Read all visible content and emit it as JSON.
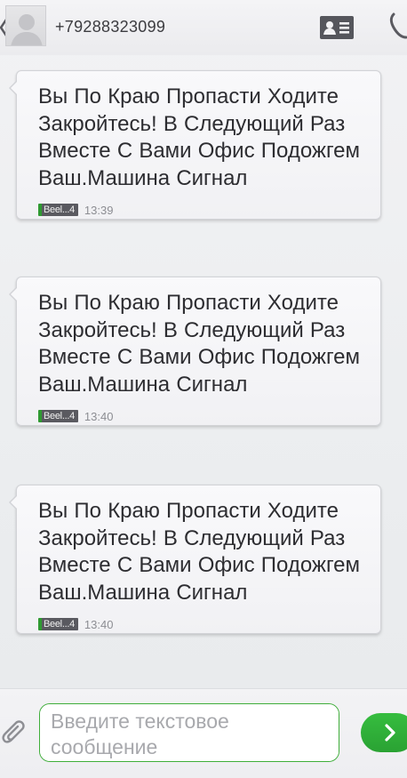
{
  "header": {
    "phone_number": "+79288323099",
    "back_icon": "chevron-left-icon",
    "avatar_icon": "contact-avatar-icon",
    "contact_card_icon": "contact-card-icon",
    "call_icon": "phone-icon"
  },
  "messages": [
    {
      "text": "Вы По Краю Пропасти Ходите Закройтесь! В Следующий Раз Вместе С Вами Офис Подожгем Ваш.Машина Сигнал",
      "sim": "Beel...4",
      "time": "13:39"
    },
    {
      "text": "Вы По Краю Пропасти Ходите Закройтесь! В Следующий Раз Вместе С Вами Офис Подожгем Ваш.Машина Сигнал",
      "sim": "Beel...4",
      "time": "13:40"
    },
    {
      "text": "Вы По Краю Пропасти Ходите Закройтесь! В Следующий Раз Вместе С Вами Офис Подожгем Ваш.Машина Сигнал",
      "sim": "Beel...4",
      "time": "13:40"
    }
  ],
  "composer": {
    "placeholder": "Введите текстовое сообщение",
    "attach_icon": "paperclip-icon",
    "send_icon": "send-arrow-icon"
  },
  "colors": {
    "accent_green": "#35b83e",
    "sim_green": "#2f9a32",
    "bubble_bg": "#f5f5f7",
    "text": "#2d2d31"
  }
}
